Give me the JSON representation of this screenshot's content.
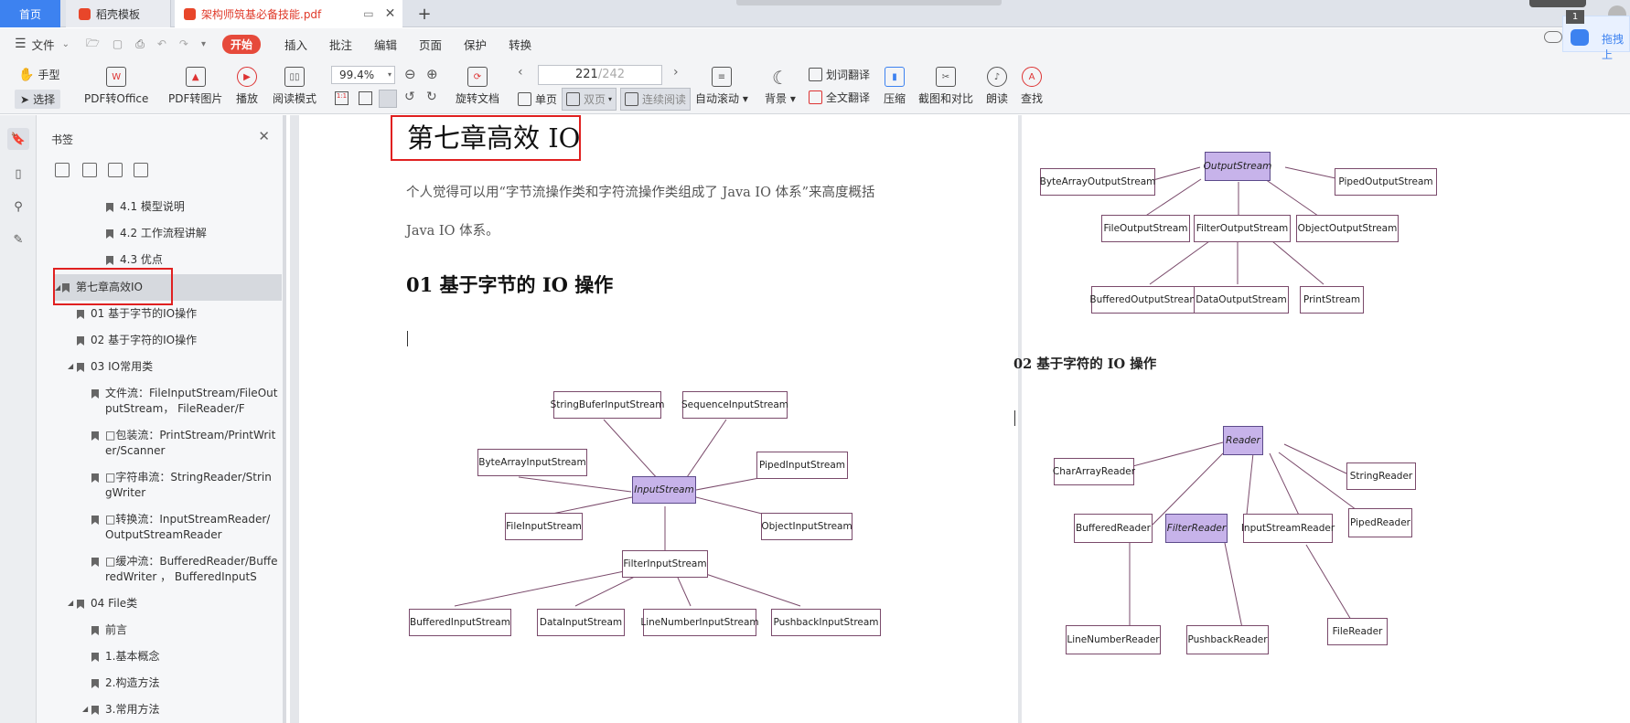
{
  "tabs": {
    "home": "首页",
    "templates": "稻壳模板",
    "pdf": "架构师筑基必备技能.pdf",
    "plus": "+"
  },
  "menu": {
    "file": "文件",
    "items": [
      "开始",
      "插入",
      "批注",
      "编辑",
      "页面",
      "保护",
      "转换"
    ],
    "drag": "拖拽上",
    "badge": "1"
  },
  "toolbar": {
    "hand": "手型",
    "select": "选择",
    "pdf_to_office": "PDF转Office",
    "pdf_to_image": "PDF转图片",
    "play": "播放",
    "read_mode": "阅读模式",
    "zoom": "99.4%",
    "rotate": "旋转文档",
    "page_current": "221",
    "page_total": "/242",
    "single": "单页",
    "double": "双页",
    "continuous": "连续阅读",
    "auto_scroll": "自动滚动",
    "background": "背景",
    "word_translate": "划词翻译",
    "full_translate": "全文翻译",
    "compress": "压缩",
    "compare": "截图和对比",
    "read_aloud": "朗读",
    "find": "查找"
  },
  "panel": {
    "title": "书签",
    "items": [
      {
        "label": "4.1 模型说明"
      },
      {
        "label": "4.2 工作流程讲解"
      },
      {
        "label": "4.3 优点"
      },
      {
        "label": "第七章高效IO"
      },
      {
        "label": "01 基于字节的IO操作"
      },
      {
        "label": "02 基于字符的IO操作"
      },
      {
        "label": "03 IO常用类"
      },
      {
        "label": "文件流：FileInputStream/FileOutputStream， FileReader/F"
      },
      {
        "label": "□包装流：PrintStream/PrintWriter/Scanner"
      },
      {
        "label": "□字符串流：StringReader/StringWriter"
      },
      {
        "label": "□转换流：InputStreamReader/OutputStreamReader"
      },
      {
        "label": "□缓冲流：BufferedReader/BufferedWriter ， BufferedInputS"
      },
      {
        "label": "04 File类"
      },
      {
        "label": "前言"
      },
      {
        "label": "1.基本概念"
      },
      {
        "label": "2.构造方法"
      },
      {
        "label": "3.常用方法"
      }
    ]
  },
  "doc": {
    "chapter_title": "第七章高效 IO",
    "intro_line1": "个人觉得可以用“字节流操作类和字符流操作类组成了 Java IO 体系”来高度概括",
    "intro_line2": "Java IO 体系。",
    "section1": "01  基于字节的 IO 操作",
    "section2": "02  基于字符的 IO 操作",
    "input_diagram": {
      "StringBufferInputStream": "StringBuferInputStream",
      "SequenceInputStream": "SequenceInputStream",
      "ByteArrayInputStream": "ByteArrayInputStream",
      "PipedInputStream": "PipedInputStream",
      "InputStream": "InputStream",
      "FileInputStream": "FileInputStream",
      "ObjectInputStream": "ObjectInputStream",
      "FilterInputStream": "FilterInputStream",
      "BufferedInputStream": "BufferedInputStream",
      "DataInputStream": "DataInputStream",
      "LineNumberInputStream": "LineNumberInputStream",
      "PushbackInputStream": "PushbackInputStream"
    },
    "output_diagram": {
      "OutputStream": "OutputStream",
      "ByteArrayOutputStream": "ByteArrayOutputStream",
      "PipedOutputStream": "PipedOutputStream",
      "FileOutputStream": "FileOutputStream",
      "FilterOutputStream": "FilterOutputStream",
      "ObjectOutputStream": "ObjectOutputStream",
      "BufferedOutputStream": "BufferedOutputStream",
      "DataOutputStream": "DataOutputStream",
      "PrintStream": "PrintStream"
    },
    "reader_diagram": {
      "Reader": "Reader",
      "CharArrayReader": "CharArrayReader",
      "StringReader": "StringReader",
      "BufferedReader": "BufferedReader",
      "FilterReader": "FilterReader",
      "InputStreamReader": "InputStreamReader",
      "PipedReader": "PipedReader",
      "LineNumberReader": "LineNumberReader",
      "PushbackReader": "PushbackReader",
      "FileReader": "FileReader"
    }
  },
  "colors": {
    "accent": "#3d82f0",
    "highlight_red": "#e02020",
    "uml_fill": "#c7b3ea",
    "uml_line": "#7a4a6b"
  }
}
